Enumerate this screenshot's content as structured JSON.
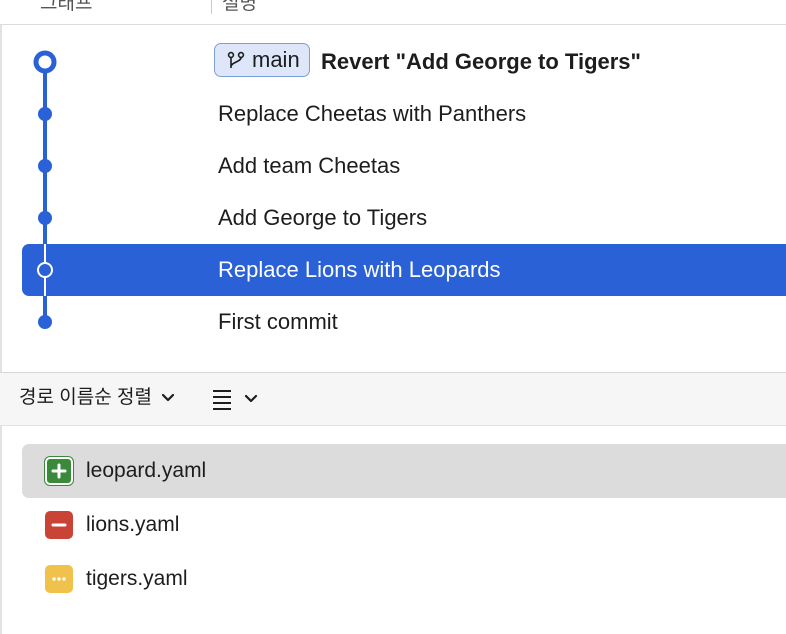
{
  "header": {
    "col_graph": "그래프",
    "col_description": "설명"
  },
  "branch": {
    "name": "main"
  },
  "commits": [
    {
      "message": "Revert \"Add George to Tigers\"",
      "is_head": true,
      "selected": false
    },
    {
      "message": "Replace Cheetas with Panthers",
      "is_head": false,
      "selected": false
    },
    {
      "message": "Add team Cheetas",
      "is_head": false,
      "selected": false
    },
    {
      "message": "Add George to Tigers",
      "is_head": false,
      "selected": false
    },
    {
      "message": "Replace Lions with Leopards",
      "is_head": false,
      "selected": true
    },
    {
      "message": "First commit",
      "is_head": false,
      "selected": false
    }
  ],
  "toolbar": {
    "sort_label": "경로 이름순 정렬",
    "sort_icon": "chevron-down-icon",
    "view_icon": "list-icon"
  },
  "files": [
    {
      "name": "leopard.yaml",
      "status": "added",
      "icon": "plus-icon",
      "selected": true
    },
    {
      "name": "lions.yaml",
      "status": "deleted",
      "icon": "minus-icon",
      "selected": false
    },
    {
      "name": "tigers.yaml",
      "status": "modified",
      "icon": "ellipsis-icon",
      "selected": false
    }
  ],
  "colors": {
    "accent": "#2a61d6",
    "graph_line": "#2a61d6",
    "added": "#3a8a3a",
    "deleted": "#c94436",
    "modified": "#f0c24c",
    "selected_file_bg": "#dcdcdc"
  }
}
